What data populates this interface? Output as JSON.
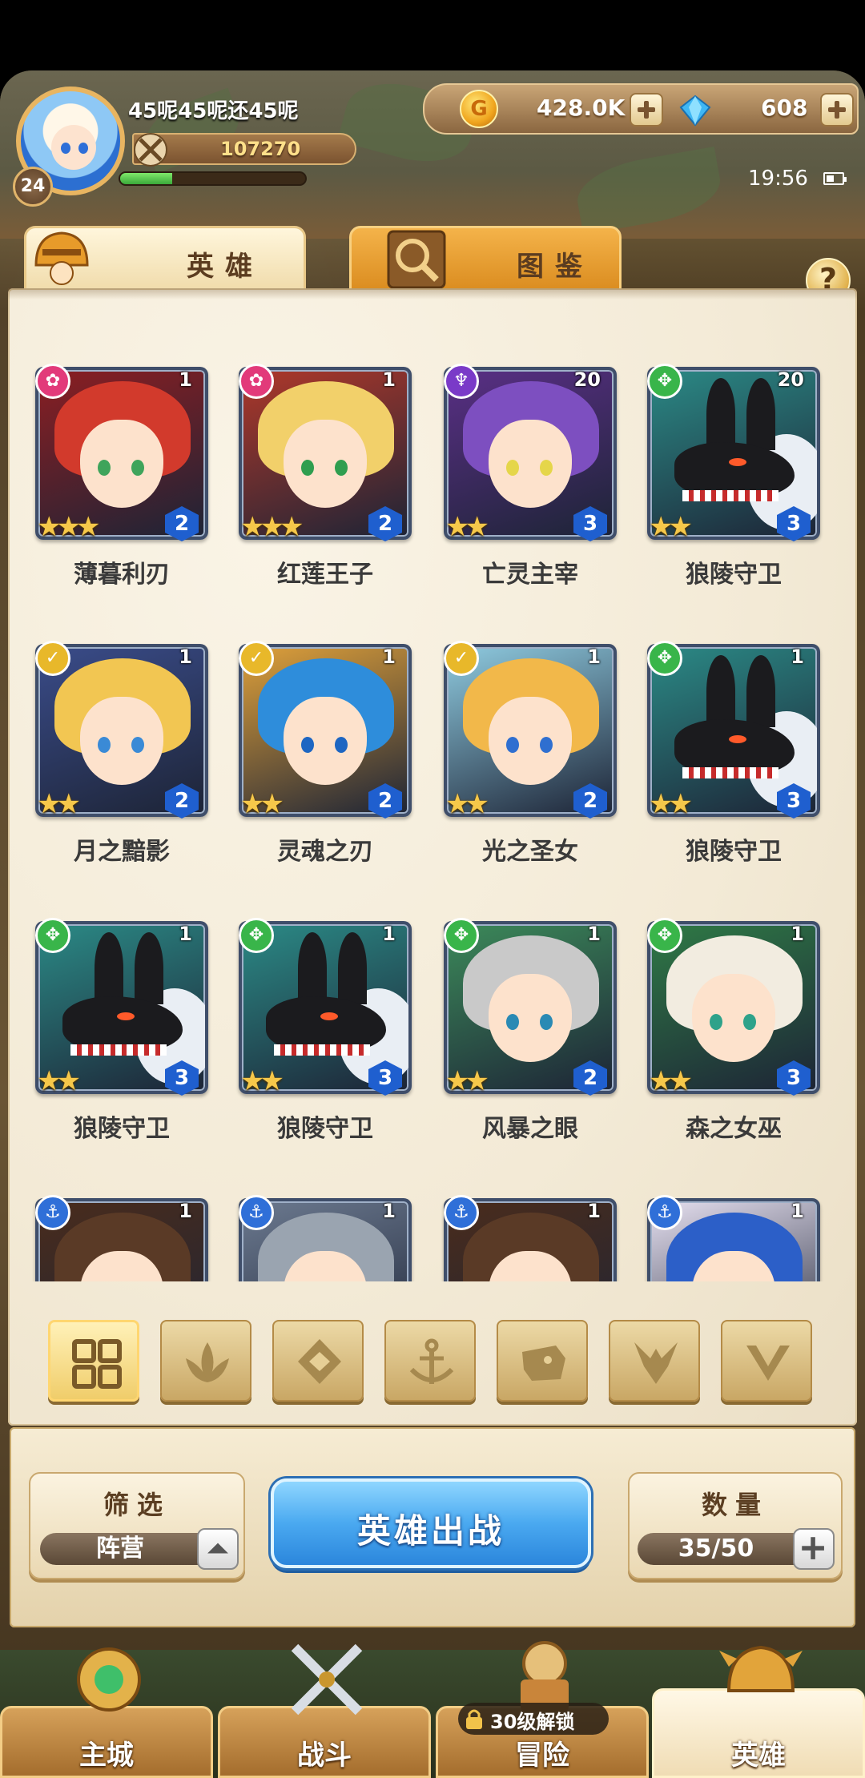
{
  "player": {
    "name": "45呢45呢还45呢",
    "level": "24",
    "power": "107270",
    "exp_fraction": 0.28
  },
  "currency": {
    "gold": "428.0K",
    "gems": "608"
  },
  "status": {
    "time": "19:56"
  },
  "tabs": {
    "heroes": "英雄",
    "codex": "图鉴"
  },
  "help_label": "?",
  "hero_rows": [
    {
      "heroes": [
        {
          "name": "薄暮利刃",
          "level": "1",
          "faction": "rose",
          "stars": 3,
          "grade": "2",
          "bg": "#8c1e22",
          "hair": "#d23a2c",
          "eyes": "#3fa45b",
          "style": "human"
        },
        {
          "name": "红莲王子",
          "level": "1",
          "faction": "rose",
          "stars": 3,
          "grade": "2",
          "bg": "#b0382a",
          "hair": "#f2d06a",
          "eyes": "#2f9e4f",
          "style": "human"
        },
        {
          "name": "亡灵主宰",
          "level": "20",
          "faction": "shadow",
          "stars": 2,
          "grade": "3",
          "bg": "#5a2f86",
          "hair": "#7d4fc0",
          "eyes": "#e5d64a",
          "style": "human"
        },
        {
          "name": "狼陵守卫",
          "level": "20",
          "faction": "beast",
          "stars": 2,
          "grade": "3",
          "bg": "#2b8a86",
          "hair": "#1b1b1e",
          "eyes": "#ff5a2a",
          "style": "beast"
        }
      ]
    },
    {
      "heroes": [
        {
          "name": "月之黯影",
          "level": "1",
          "faction": "light",
          "stars": 2,
          "grade": "2",
          "bg": "#3a4c8a",
          "hair": "#f2c652",
          "eyes": "#3a8ad6",
          "style": "human"
        },
        {
          "name": "灵魂之刃",
          "level": "1",
          "faction": "light",
          "stars": 2,
          "grade": "2",
          "bg": "#e0a13a",
          "hair": "#2e8ddb",
          "eyes": "#1d66c2",
          "style": "human"
        },
        {
          "name": "光之圣女",
          "level": "1",
          "faction": "light",
          "stars": 2,
          "grade": "2",
          "bg": "#8fcbe0",
          "hair": "#f2b84a",
          "eyes": "#2f6fd0",
          "style": "human"
        },
        {
          "name": "狼陵守卫",
          "level": "1",
          "faction": "beast",
          "stars": 2,
          "grade": "3",
          "bg": "#2b8a86",
          "hair": "#1b1b1e",
          "eyes": "#ff5a2a",
          "style": "beast"
        }
      ]
    },
    {
      "heroes": [
        {
          "name": "狼陵守卫",
          "level": "1",
          "faction": "beast",
          "stars": 2,
          "grade": "3",
          "bg": "#2b8a86",
          "hair": "#1b1b1e",
          "eyes": "#ff5a2a",
          "style": "beast"
        },
        {
          "name": "狼陵守卫",
          "level": "1",
          "faction": "beast",
          "stars": 2,
          "grade": "3",
          "bg": "#2b8a86",
          "hair": "#1b1b1e",
          "eyes": "#ff5a2a",
          "style": "beast"
        },
        {
          "name": "风暴之眼",
          "level": "1",
          "faction": "beast",
          "stars": 2,
          "grade": "2",
          "bg": "#3c8a5a",
          "hair": "#c9c9c9",
          "eyes": "#2a8ab4",
          "style": "human"
        },
        {
          "name": "森之女巫",
          "level": "1",
          "faction": "beast",
          "stars": 2,
          "grade": "3",
          "bg": "#2f7a46",
          "hair": "#f2ece0",
          "eyes": "#2ea28a",
          "style": "human"
        }
      ]
    },
    {
      "heroes": [
        {
          "name": "",
          "level": "1",
          "faction": "anchor",
          "stars": 0,
          "grade": "",
          "bg": "#4a2c1c",
          "hair": "#5a3a26",
          "eyes": "#000",
          "style": "human"
        },
        {
          "name": "",
          "level": "1",
          "faction": "anchor",
          "stars": 0,
          "grade": "",
          "bg": "#6c7a90",
          "hair": "#9aa4b0",
          "eyes": "#000",
          "style": "human"
        },
        {
          "name": "",
          "level": "1",
          "faction": "anchor",
          "stars": 0,
          "grade": "",
          "bg": "#4a2c1c",
          "hair": "#5a3a26",
          "eyes": "#000",
          "style": "human"
        },
        {
          "name": "",
          "level": "1",
          "faction": "anchor",
          "stars": 0,
          "grade": "",
          "bg": "#e6e0f0",
          "hair": "#2c5fc8",
          "eyes": "#000",
          "style": "human"
        }
      ]
    }
  ],
  "faction_colors": {
    "rose": "#e23a7a",
    "shadow": "#7a3ac8",
    "beast": "#39b54a",
    "light": "#e8b82a",
    "anchor": "#2f6fd8"
  },
  "faction_filters": [
    "all",
    "rose",
    "light-crystal",
    "anchor",
    "beast",
    "shadow",
    "light-v"
  ],
  "filter": {
    "label": "筛选",
    "value": "阵营"
  },
  "deploy_button": "英雄出战",
  "count": {
    "label": "数量",
    "value": "35/50"
  },
  "nav": [
    {
      "id": "main-city",
      "label": "主城",
      "active": false
    },
    {
      "id": "battle",
      "label": "战斗",
      "active": false
    },
    {
      "id": "adventure",
      "label": "冒险",
      "active": false
    },
    {
      "id": "heroes",
      "label": "英雄",
      "active": true
    }
  ],
  "lock_tag": "30级解锁"
}
